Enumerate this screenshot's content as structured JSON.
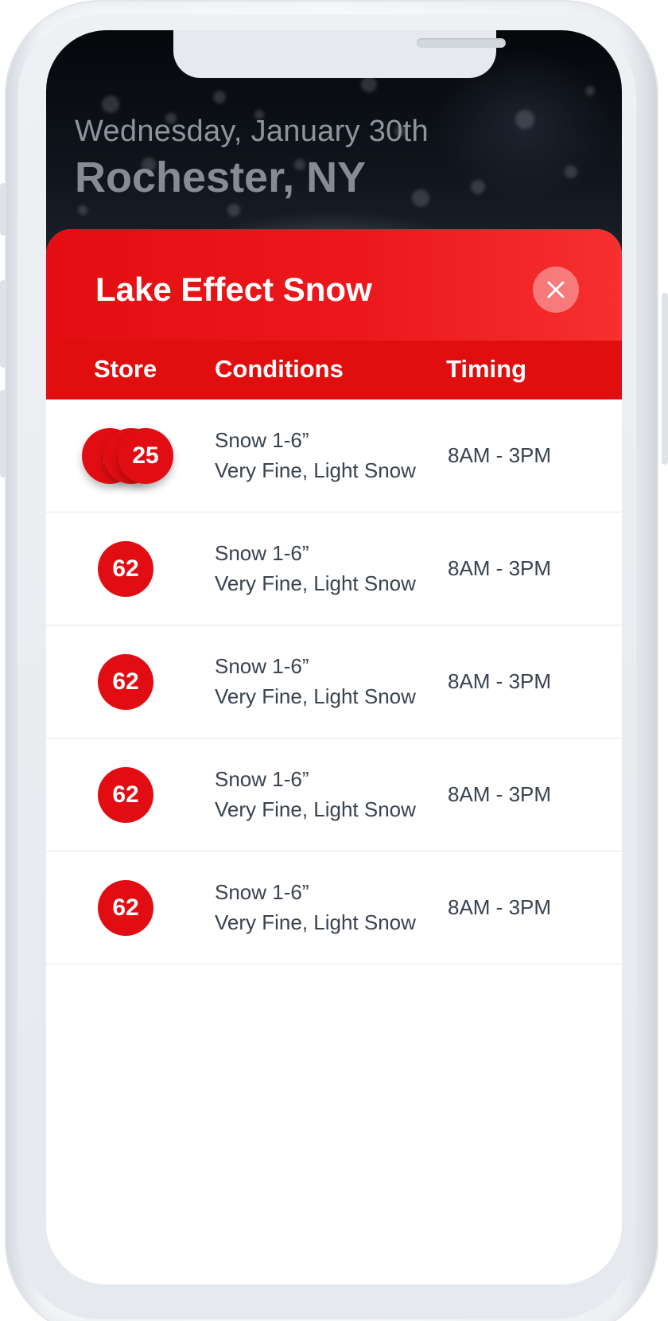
{
  "header": {
    "date": "Wednesday, January 30th",
    "city": "Rochester, NY"
  },
  "alert": {
    "title": "Lake Effect Snow",
    "close_icon": "close-icon",
    "columns": {
      "store": "Store",
      "conditions": "Conditions",
      "timing": "Timing"
    },
    "rows": [
      {
        "stores": [
          "2",
          "2",
          "25"
        ],
        "condition_amount": "Snow 1-6”",
        "condition_desc": "Very Fine, Light Snow",
        "timing": "8AM - 3PM"
      },
      {
        "stores": [
          "62"
        ],
        "condition_amount": "Snow 1-6”",
        "condition_desc": "Very Fine, Light Snow",
        "timing": "8AM - 3PM"
      },
      {
        "stores": [
          "62"
        ],
        "condition_amount": "Snow 1-6”",
        "condition_desc": "Very Fine, Light Snow",
        "timing": "8AM - 3PM"
      },
      {
        "stores": [
          "62"
        ],
        "condition_amount": "Snow 1-6”",
        "condition_desc": "Very Fine, Light Snow",
        "timing": "8AM - 3PM"
      },
      {
        "stores": [
          "62"
        ],
        "condition_amount": "Snow 1-6”",
        "condition_desc": "Very Fine, Light Snow",
        "timing": "8AM - 3PM"
      }
    ]
  },
  "colors": {
    "accent_red": "#e10d12",
    "header_red_light": "#f6302f",
    "text_dark": "#3a4250"
  }
}
